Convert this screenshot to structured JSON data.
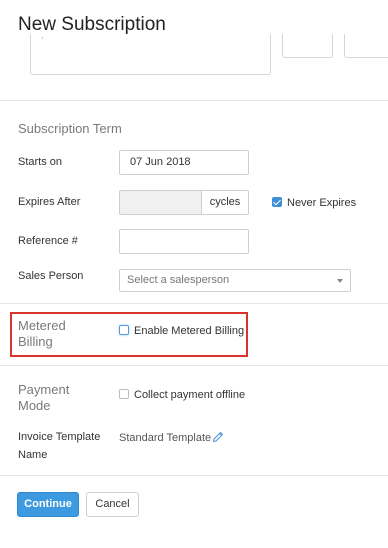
{
  "header": {
    "title": "New Subscription"
  },
  "top_box": {
    "text": ","
  },
  "subscription_term": {
    "title": "Subscription Term",
    "starts_on": {
      "label": "Starts on",
      "value": "07 Jun 2018"
    },
    "expires_after": {
      "label": "Expires After",
      "value": "",
      "addon": "cycles"
    },
    "never_expires": {
      "label": "Never Expires",
      "checked": true
    },
    "reference": {
      "label": "Reference #",
      "value": ""
    },
    "sales_person": {
      "label": "Sales Person",
      "placeholder": "Select a salesperson"
    }
  },
  "metered_billing": {
    "title_line1": "Metered",
    "title_line2": "Billing",
    "checkbox_label": "Enable Metered Billing",
    "checked": false,
    "highlight_color": "#d9342b"
  },
  "payment_mode": {
    "title_line1": "Payment",
    "title_line2": "Mode",
    "checkbox_label": "Collect payment offline",
    "checked": false
  },
  "invoice_template": {
    "label_line1": "Invoice Template",
    "label_line2": "Name",
    "value": "Standard Template",
    "edit_icon": "pencil-icon"
  },
  "footer": {
    "continue_label": "Continue",
    "cancel_label": "Cancel",
    "primary_color": "#3d9ae0"
  }
}
